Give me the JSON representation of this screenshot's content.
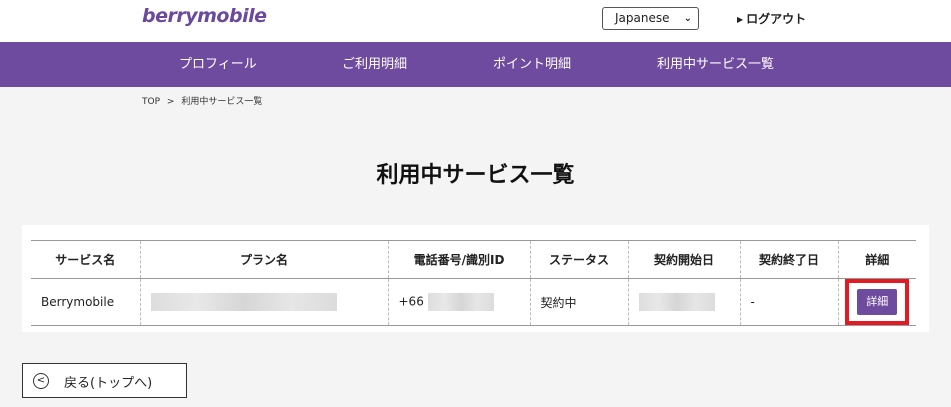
{
  "header": {
    "logo": "berrymobile",
    "language": "Japanese",
    "logout": "ログアウト"
  },
  "nav": {
    "items": [
      {
        "label": "プロフィール"
      },
      {
        "label": "ご利用明細"
      },
      {
        "label": "ポイント明細"
      },
      {
        "label": "利用中サービス一覧"
      }
    ]
  },
  "breadcrumb": {
    "home": "TOP",
    "separator": ">",
    "current": "利用中サービス一覧"
  },
  "page": {
    "title": "利用中サービス一覧"
  },
  "table": {
    "headers": [
      "サービス名",
      "プラン名",
      "電話番号/識別ID",
      "ステータス",
      "契約開始日",
      "契約終了日",
      "詳細"
    ],
    "rows": [
      {
        "service": "Berrymobile",
        "plan": "",
        "phone_prefix": "+66",
        "status": "契約中",
        "start_date": "",
        "end_date": "-",
        "detail_label": "詳細"
      }
    ]
  },
  "footer": {
    "back_label": "戻る(トップへ)"
  },
  "colors": {
    "brand_purple": "#6f4ba0",
    "highlight_red": "#e01b24",
    "background": "#f4f4f4"
  },
  "icons": {
    "back": "chevron-left-circle-icon",
    "logout": "triangle-right-icon",
    "select": "chevron-down-icon"
  }
}
